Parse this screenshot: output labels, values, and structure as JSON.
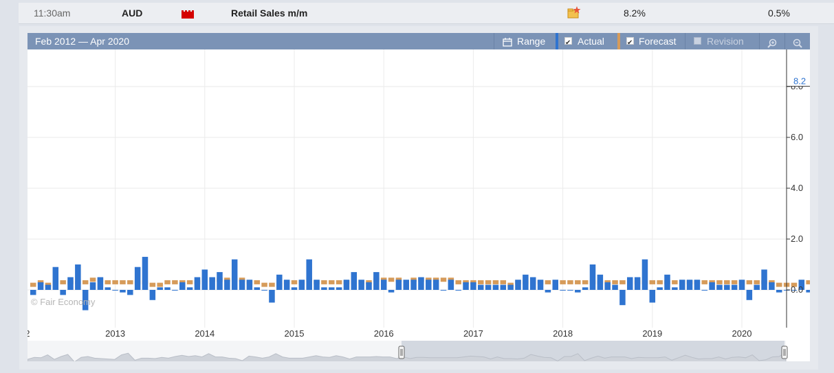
{
  "event": {
    "time": "11:30am",
    "currency": "AUD",
    "impact_icon": "high-impact-folder-icon",
    "impact_color": "#d40000",
    "title": "Retail Sales m/m",
    "detail_icon": "detail-star-icon",
    "actual": "8.2%",
    "forecast": "0.5%"
  },
  "toolbar": {
    "date_range": "Feb 2012 — Apr 2020",
    "range_label": "Range",
    "actual_label": "Actual",
    "forecast_label": "Forecast",
    "revision_label": "Revision",
    "actual_checked": true,
    "forecast_checked": true,
    "revision_checked": false,
    "zoom_in_icon": "zoom-in-icon",
    "zoom_out_icon": "zoom-out-icon",
    "range_icon": "calendar-icon"
  },
  "watermark": "© Fair Economy",
  "navigator": {
    "handle_icon": "scroll-grip-icon",
    "updown_icon": "up-down-arrows-icon"
  },
  "colors": {
    "actual": "#2f74d0",
    "forecast": "#d69b5a",
    "toolbar": "#7b93b6"
  },
  "chart_data": {
    "type": "bar",
    "title": "",
    "xlabel": "",
    "ylabel": "",
    "x_start": "2012-02",
    "x_end": "2020-04",
    "x_tick_labels": [
      ".2",
      "2013",
      "2014",
      "2015",
      "2016",
      "2017",
      "2018",
      "2019",
      "2020"
    ],
    "y_ticks": [
      0.0,
      2.0,
      4.0,
      6.0,
      8.0
    ],
    "y_tick_labels": [
      "0.0",
      "2.0",
      "4.0",
      "6.0",
      "8.0"
    ],
    "ylim": [
      -0.9,
      8.5
    ],
    "last_value_label": "8.2",
    "grid": true,
    "series": [
      {
        "name": "Actual",
        "values": [
          -0.2,
          0.3,
          0.2,
          0.9,
          -0.2,
          0.5,
          1.0,
          -0.8,
          0.3,
          0.5,
          0.1,
          0.0,
          -0.1,
          -0.2,
          0.9,
          1.3,
          -0.4,
          0.1,
          0.1,
          0.0,
          0.3,
          0.1,
          0.5,
          0.8,
          0.5,
          0.7,
          0.4,
          1.2,
          0.4,
          0.4,
          0.1,
          0.0,
          -0.5,
          0.6,
          0.4,
          0.1,
          0.4,
          1.2,
          0.4,
          0.1,
          0.1,
          0.1,
          0.4,
          0.7,
          0.4,
          0.3,
          0.7,
          0.4,
          -0.1,
          0.4,
          0.4,
          0.4,
          0.5,
          0.4,
          0.4,
          0.0,
          0.4,
          0.0,
          0.3,
          0.3,
          0.2,
          0.2,
          0.2,
          0.2,
          0.2,
          0.4,
          0.6,
          0.5,
          0.4,
          -0.1,
          0.4,
          0.0,
          0.0,
          -0.1,
          0.1,
          1.0,
          0.6,
          0.3,
          0.2,
          -0.6,
          0.5,
          0.5,
          1.2,
          -0.5,
          0.1,
          0.6,
          0.1,
          0.4,
          0.4,
          0.4,
          0.0,
          0.3,
          0.2,
          0.2,
          0.2,
          0.4,
          -0.4,
          0.2,
          0.8,
          0.3,
          -0.1,
          0.0,
          0.0,
          0.4,
          -0.1,
          0.3,
          0.4,
          0.2,
          0.9,
          -0.5,
          -0.3,
          0.4,
          0.5,
          8.2
        ]
      },
      {
        "name": "Forecast",
        "values": [
          0.2,
          0.3,
          0.2,
          0.3,
          0.3,
          0.3,
          0.3,
          0.3,
          0.4,
          0.4,
          0.3,
          0.3,
          0.3,
          0.3,
          0.3,
          0.3,
          0.2,
          0.2,
          0.3,
          0.3,
          0.3,
          0.3,
          0.3,
          0.4,
          0.4,
          0.4,
          0.4,
          0.4,
          0.4,
          0.3,
          0.3,
          0.2,
          0.2,
          0.2,
          0.3,
          0.3,
          0.3,
          0.4,
          0.3,
          0.3,
          0.3,
          0.3,
          0.3,
          0.3,
          0.3,
          0.3,
          0.4,
          0.4,
          0.4,
          0.4,
          0.3,
          0.4,
          0.4,
          0.4,
          0.4,
          0.4,
          0.4,
          0.3,
          0.3,
          0.3,
          0.3,
          0.3,
          0.3,
          0.3,
          0.2,
          0.3,
          0.3,
          0.3,
          0.3,
          0.3,
          0.3,
          0.3,
          0.3,
          0.3,
          0.3,
          0.3,
          0.3,
          0.3,
          0.3,
          0.3,
          0.3,
          0.3,
          0.3,
          0.3,
          0.3,
          0.3,
          0.3,
          0.3,
          0.3,
          0.3,
          0.3,
          0.3,
          0.3,
          0.3,
          0.3,
          0.3,
          0.3,
          0.3,
          0.3,
          0.3,
          0.2,
          0.2,
          0.2,
          0.3,
          0.3,
          0.3,
          0.3,
          0.3,
          0.3,
          0.3,
          0.3,
          0.2,
          0.3,
          0.5
        ]
      }
    ]
  }
}
